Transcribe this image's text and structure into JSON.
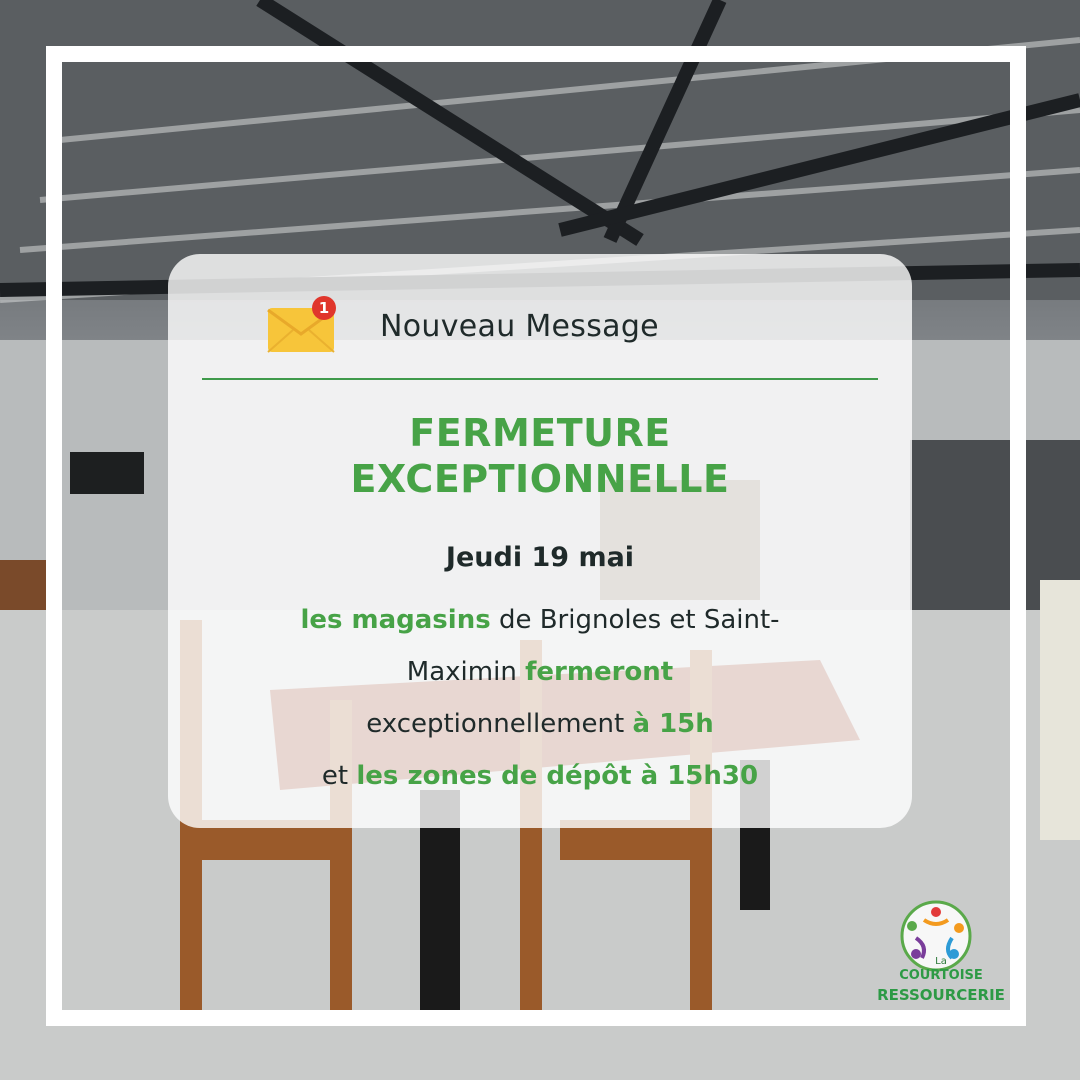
{
  "message": {
    "badge_count": "1",
    "header_title": "Nouveau Message",
    "headline_line1": "FERMETURE",
    "headline_line2": "EXCEPTIONNELLE",
    "date": "Jeudi 19 mai",
    "line1_green": "les magasins",
    "line1_rest": " de Brignoles et Saint-",
    "line2_start": "Maximin ",
    "line2_green": "fermeront",
    "line3_start": "exceptionnellement ",
    "line3_green": "à 15h",
    "line4_start": "et ",
    "line4_green": "les zones de dépôt à 15h30"
  },
  "logo": {
    "small": "La",
    "line1": "COURTOISE",
    "line2": "RESSOURCERIE"
  },
  "colors": {
    "accent_green": "#47a347",
    "envelope": "#f7c53a",
    "badge": "#e0362c"
  }
}
